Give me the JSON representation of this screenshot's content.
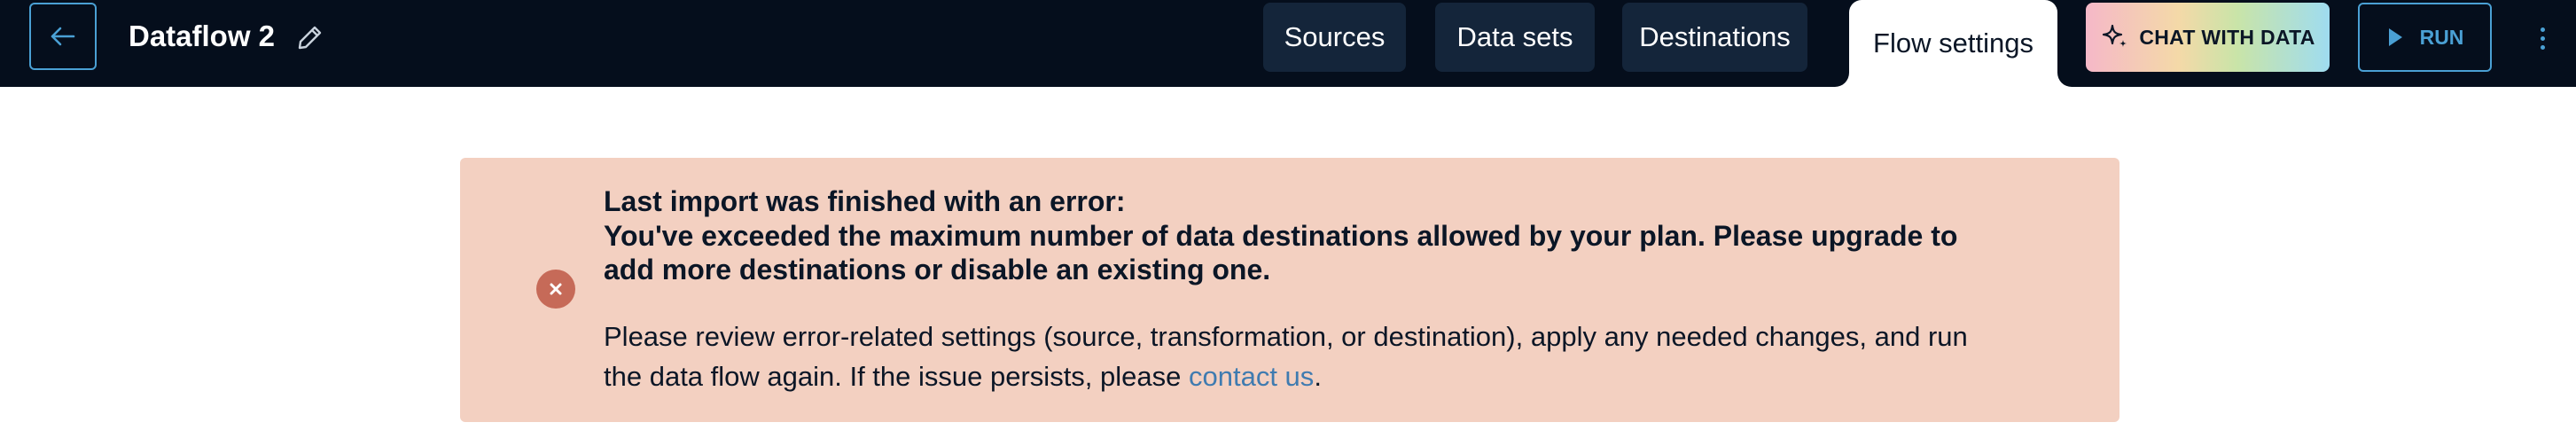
{
  "header": {
    "back_icon": "arrow-left-icon",
    "title": "Dataflow 2",
    "edit_icon": "pencil-icon",
    "tabs": [
      {
        "label": "Sources",
        "active": false
      },
      {
        "label": "Data sets",
        "active": false
      },
      {
        "label": "Destinations",
        "active": false
      },
      {
        "label": "Flow settings",
        "active": true
      }
    ],
    "chat_button": {
      "icon": "sparkle-icon",
      "label": "CHAT WITH DATA"
    },
    "run_button": {
      "icon": "play-icon",
      "label": "RUN"
    },
    "more_icon": "vertical-ellipsis-icon"
  },
  "alert": {
    "icon": "error-x-icon",
    "heading_line1": "Last import was finished with an error:",
    "heading_line2": "You've exceeded the maximum number of data destinations allowed by your plan. Please upgrade to",
    "heading_line3": "add more destinations or disable an existing one.",
    "body_line1": "Please review error-related settings (source, transformation, or destination), apply any needed changes, and run",
    "body_line2_prefix": "the data flow again. If the issue persists, please ",
    "body_link": "contact us",
    "body_line2_suffix": "."
  },
  "colors": {
    "topbar_bg": "#050e1c",
    "tab_bg": "#14253a",
    "accent": "#4aa0d4",
    "alert_bg": "#f3d0c1",
    "error_icon": "#c66a58",
    "link": "#3f7bb0"
  }
}
